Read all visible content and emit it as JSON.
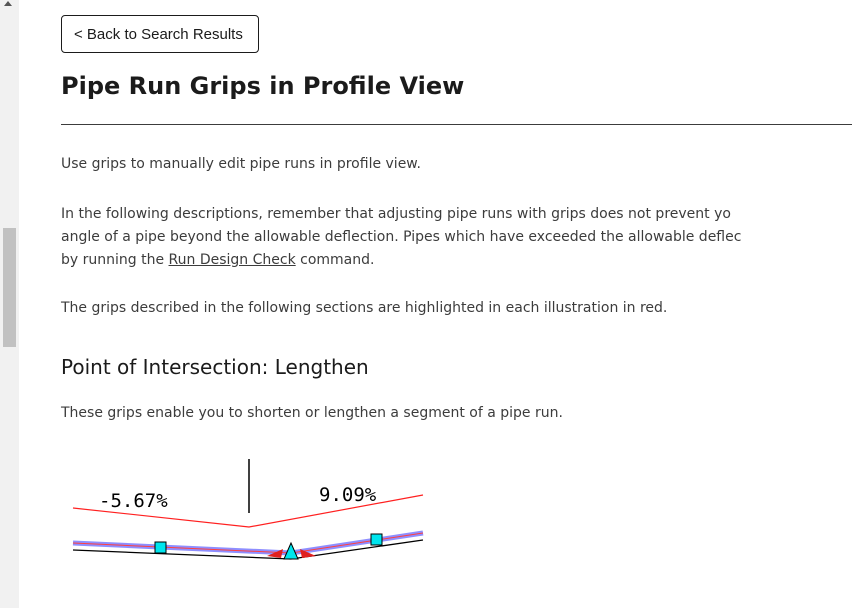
{
  "back_button": {
    "label": "< Back to Search Results"
  },
  "page_title": "Pipe Run Grips in Profile View",
  "intro": "Use grips to manually edit pipe runs in profile view.",
  "description": {
    "line1": "In the following descriptions, remember that adjusting pipe runs with grips does not prevent yo",
    "line2": "angle of a pipe beyond the allowable deflection. Pipes which have exceeded the allowable deflec",
    "line3_before": "by running the ",
    "line3_link": "Run Design Check",
    "line3_after": " command."
  },
  "grips_note": "The grips described in the following sections are highlighted in each illustration in red.",
  "section": {
    "title": "Point of Intersection: Lengthen",
    "text": "These grips enable you to shorten or lengthen a segment of a pipe run."
  },
  "illustration": {
    "left_slope": "-5.67%",
    "right_slope": "9.09%",
    "colors": {
      "grade_line": "#ff2020",
      "pipe": "#7a7aff",
      "grip": "#00e5ee",
      "arrow": "#e02020"
    }
  }
}
